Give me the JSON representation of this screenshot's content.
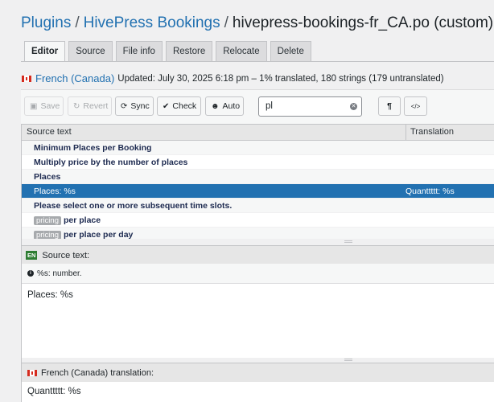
{
  "breadcrumb": {
    "root": "Plugins",
    "sep": "/",
    "plugin": "HivePress Bookings",
    "file": "hivepress-bookings-fr_CA.po (custom)"
  },
  "tabs": [
    "Editor",
    "Source",
    "File info",
    "Restore",
    "Relocate",
    "Delete"
  ],
  "status": {
    "locale": "French (Canada)",
    "meta": "Updated: July 30, 2025 6:18 pm – 1% translated, 180 strings (179 untranslated)"
  },
  "toolbar": {
    "save": "Save",
    "revert": "Revert",
    "sync": "Sync",
    "check": "Check",
    "auto": "Auto",
    "search_value": "pl",
    "pilcrow": "¶",
    "code": "</>"
  },
  "grid": {
    "col_source": "Source text",
    "col_translation": "Translation",
    "rows": [
      {
        "source": "Minimum Places per Booking",
        "context": "",
        "translation": ""
      },
      {
        "source": "Multiply price by the number of places",
        "context": "",
        "translation": ""
      },
      {
        "source": "Places",
        "context": "",
        "translation": ""
      },
      {
        "source": "Places: %s",
        "context": "",
        "translation": "Quanttttt: %s"
      },
      {
        "source": "Please select one or more subsequent time slots.",
        "context": "",
        "translation": ""
      },
      {
        "source": "per place",
        "context": "pricing",
        "translation": ""
      },
      {
        "source": "per place per day",
        "context": "pricing",
        "translation": ""
      }
    ]
  },
  "source_pane": {
    "badge": "EN",
    "label": "Source text:",
    "comment": "%s: number.",
    "text": "Places: %s"
  },
  "translation_pane": {
    "label": "French (Canada) translation:",
    "text": "Quanttttt: %s"
  },
  "colors": {
    "accent": "#2271b1",
    "selected_row": "#2271b1",
    "badge_en": "#2e7d32"
  }
}
